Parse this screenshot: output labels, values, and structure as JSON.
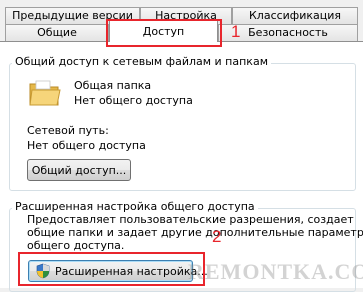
{
  "tabs": {
    "row1": [
      "Предыдущие версии",
      "Настройка",
      "Классификация"
    ],
    "row2": [
      "Общие",
      "Доступ",
      "Безопасность"
    ]
  },
  "sharing_group": {
    "title": "Общий доступ к сетевым файлам и папкам",
    "folder_name": "Общая папка",
    "folder_status": "Нет общего доступа",
    "network_path_label": "Сетевой путь:",
    "network_path_value": "Нет общего доступа",
    "share_button": "Общий доступ..."
  },
  "advanced_group": {
    "title": "Расширенная настройка общего доступа",
    "description_line1": "Предоставляет пользовательские разрешения, создает",
    "description_line2": "общие папки и задает другие дополнительные параметры",
    "description_line3": "общего доступа.",
    "advanced_button": "Расширенная настройка..."
  },
  "annotations": {
    "marker1": "1",
    "marker2": "2",
    "accent_color": "#e8252c"
  },
  "watermark": "REMONTKA.COM",
  "icons": {
    "folder": "folder-icon",
    "shield": "uac-shield-icon"
  }
}
